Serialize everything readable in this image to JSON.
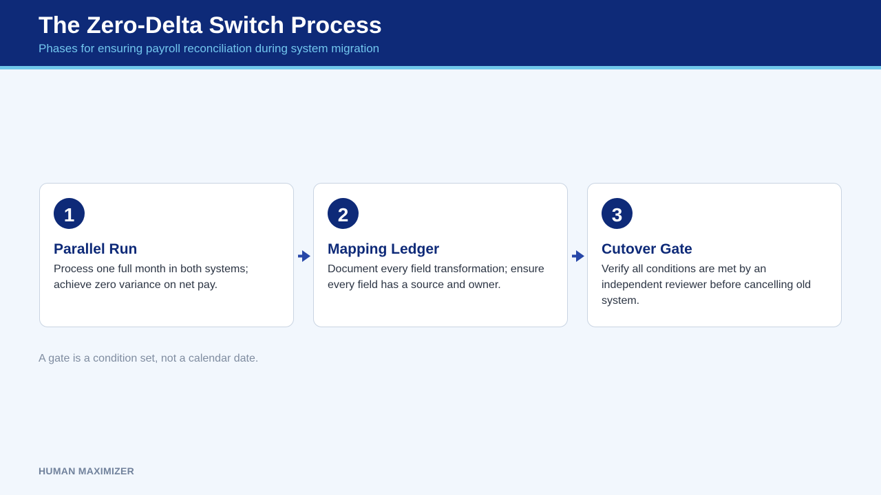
{
  "header": {
    "title": "The Zero-Delta Switch Process",
    "subtitle": "Phases for ensuring payroll reconciliation during system migration"
  },
  "phases": [
    {
      "number": "1",
      "title": "Parallel Run",
      "description": "Process one full month in both systems; achieve zero variance on net pay."
    },
    {
      "number": "2",
      "title": "Mapping Ledger",
      "description": "Document every field transformation; ensure every field has a source and owner."
    },
    {
      "number": "3",
      "title": "Cutover Gate",
      "description": "Verify all conditions are met by an independent reviewer before cancelling old system."
    }
  ],
  "note": "A gate is a condition set, not a calendar date.",
  "footer": {
    "brand": "HUMAN MAXIMIZER"
  },
  "icons": {
    "flow_arrow": "arrow-right-icon"
  },
  "colors": {
    "header_bg": "#0e2a78",
    "accent_stripe": "#6fc7ea",
    "subtitle": "#72c6ee",
    "page_bg": "#f2f7fd",
    "arrow": "#2747a8"
  }
}
